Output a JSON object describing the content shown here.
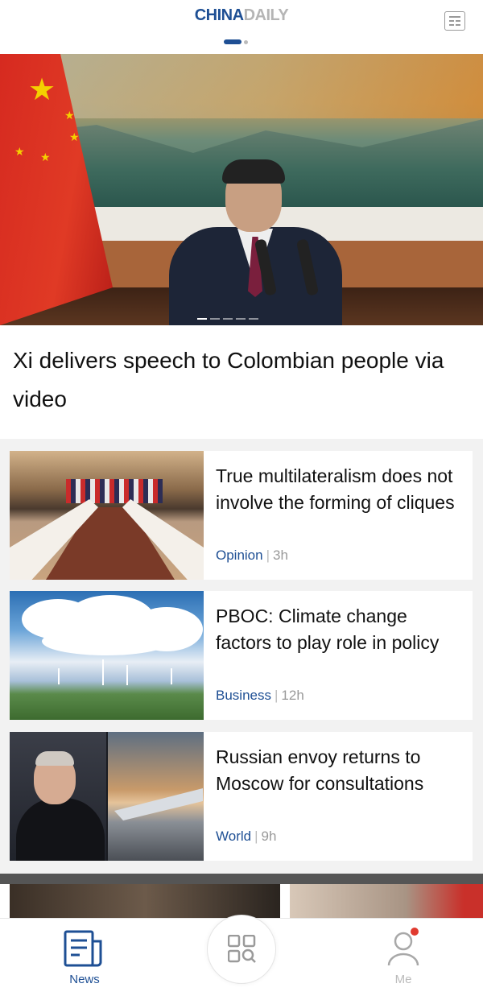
{
  "header": {
    "logo_part1": "CHINA",
    "logo_part2": "DAILY",
    "menu_icon": "newspaper-menu-icon",
    "page_indicator": {
      "pages": 2,
      "active": 1
    }
  },
  "hero": {
    "headline": "Xi delivers speech to Colombian people via video",
    "carousel": {
      "slides": 5,
      "active": 1
    }
  },
  "articles": [
    {
      "title": "True multilateralism does not involve the forming of cliques",
      "category": "Opinion",
      "separator": "|",
      "time": "3h"
    },
    {
      "title": "PBOC: Climate change factors to play role in policy",
      "category": "Business",
      "separator": "|",
      "time": "12h"
    },
    {
      "title": "Russian envoy returns to Moscow for consultations",
      "category": "World",
      "separator": "|",
      "time": "9h"
    }
  ],
  "bottom_nav": {
    "news_label": "News",
    "me_label": "Me",
    "news_icon": "newspaper-icon",
    "center_icon": "grid-search-icon",
    "me_icon": "user-icon"
  },
  "colors": {
    "brand_blue": "#1e4f94",
    "muted_gray": "#999999",
    "notification_red": "#e03a2f"
  }
}
